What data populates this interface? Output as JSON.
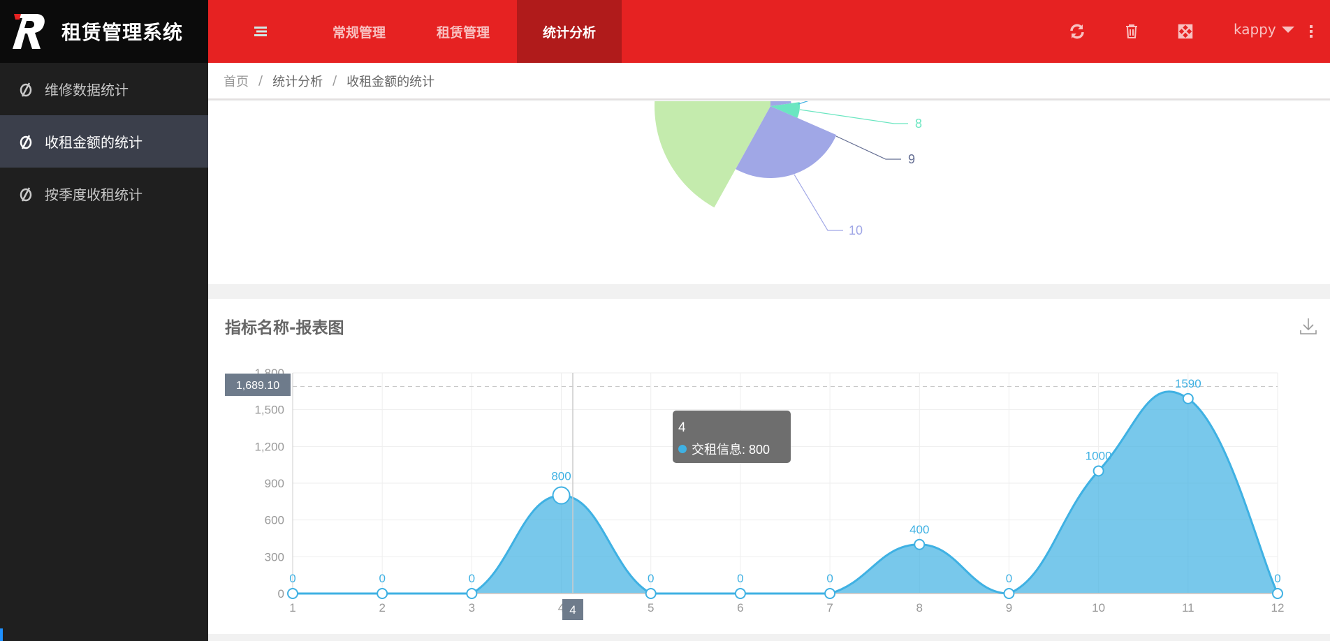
{
  "app": {
    "title": "租赁管理系统"
  },
  "sidebar": {
    "items": [
      {
        "label": "维修数据统计"
      },
      {
        "label": "收租金额的统计",
        "active": true
      },
      {
        "label": "按季度收租统计"
      }
    ]
  },
  "header": {
    "menu": [
      {
        "label": "常规管理"
      },
      {
        "label": "租赁管理"
      },
      {
        "label": "统计分析",
        "active": true
      }
    ],
    "icons": [
      "menu-toggle-icon",
      "refresh-icon",
      "trash-icon",
      "fullscreen-icon",
      "more-vertical-icon"
    ],
    "user": "kappy",
    "colors": {
      "bar": "#e62222",
      "active": "#b01b1b"
    }
  },
  "breadcrumb": [
    "首页",
    "统计分析",
    "收租金额的统计"
  ],
  "chart_data": [
    {
      "type": "pie",
      "rose": true,
      "visible_labels": [
        "8",
        "9",
        "10"
      ],
      "colors": {
        "8": "#6be6c1",
        "9": "#626c91",
        "10": "#a0a7e6",
        "other": "#c4ebad"
      }
    },
    {
      "type": "area",
      "title": "指标名称-报表图",
      "smooth": true,
      "categories": [
        "1",
        "2",
        "3",
        "4",
        "5",
        "6",
        "7",
        "8",
        "9",
        "10",
        "11",
        "12"
      ],
      "series": [
        {
          "name": "交租信息",
          "values": [
            0,
            0,
            0,
            800,
            0,
            0,
            0,
            400,
            0,
            1000,
            1590,
            0
          ]
        }
      ],
      "ylim": [
        0,
        1800
      ],
      "yticks": [
        "0",
        "300",
        "600",
        "900",
        "1,200",
        "1,500",
        "1,800"
      ],
      "markline": {
        "value": 1689.1,
        "label": "1,689.10"
      },
      "tooltip": {
        "title": "4",
        "series": "交租信息",
        "value": "800"
      },
      "axis_pointer_label": "4",
      "grid": true,
      "color": "#3fb1e3"
    }
  ]
}
